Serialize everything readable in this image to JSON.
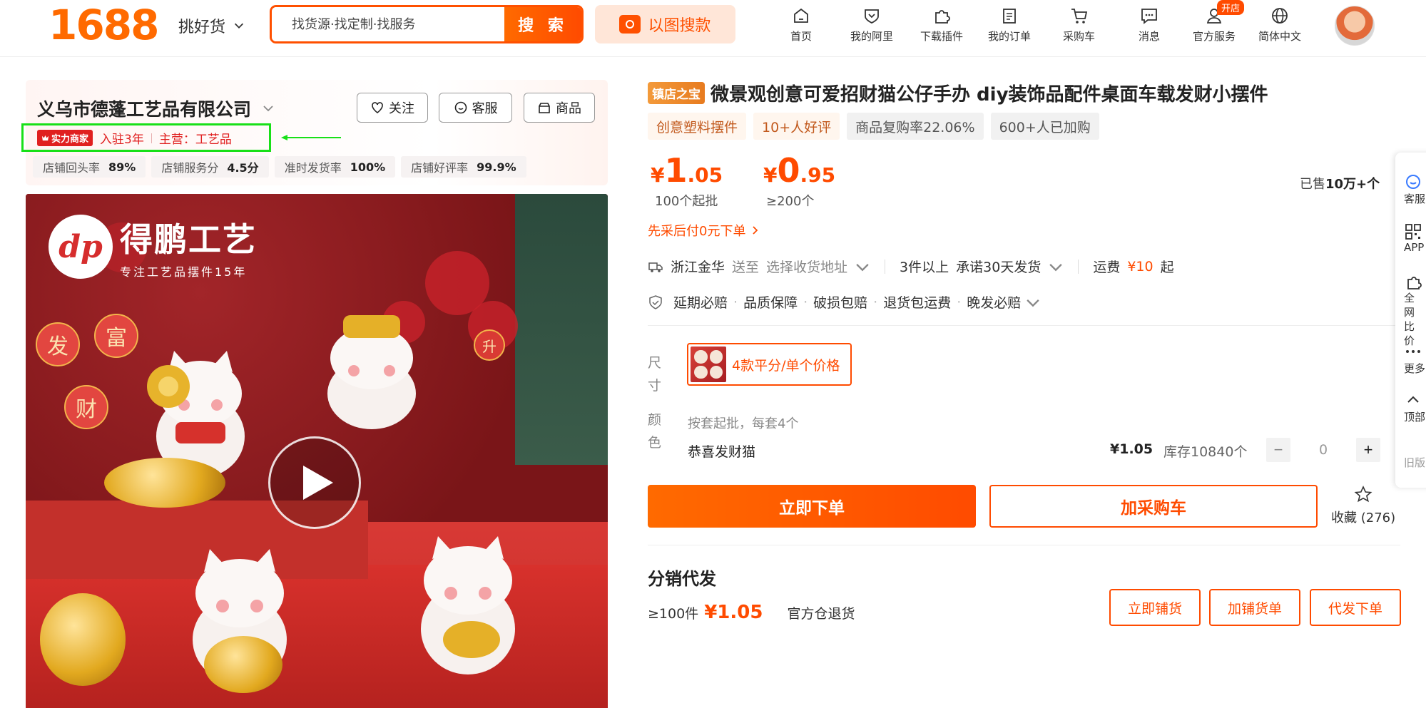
{
  "header": {
    "logo": "1688",
    "pick_goods": "挑好货",
    "search_placeholder": "找货源·找定制·找服务",
    "search_button": "搜 索",
    "image_search": "以图搜款",
    "open_shop_badge": "开店",
    "nav": [
      {
        "label": "首页",
        "icon": "home-icon"
      },
      {
        "label": "我的阿里",
        "icon": "heart-shield-icon"
      },
      {
        "label": "下载插件",
        "icon": "puzzle-icon"
      },
      {
        "label": "我的订单",
        "icon": "clipboard-icon"
      },
      {
        "label": "采购车",
        "icon": "cart-icon"
      },
      {
        "label": "消息",
        "icon": "message-icon"
      },
      {
        "label": "官方服务",
        "icon": "user-icon"
      },
      {
        "label": "简体中文",
        "icon": "globe-icon"
      }
    ]
  },
  "shop": {
    "name": "义乌市德蓬工艺品有限公司",
    "follow": "关注",
    "service": "客服",
    "goods": "商品",
    "strength_badge": "实力商家",
    "years": "入驻3年",
    "main": "主营：工艺品",
    "stats": [
      {
        "label": "店铺回头率",
        "value": "89%"
      },
      {
        "label": "店铺服务分",
        "value": "4.5分"
      },
      {
        "label": "准时发货率",
        "value": "100%"
      },
      {
        "label": "店铺好评率",
        "value": "99.9%"
      }
    ]
  },
  "image": {
    "brand_mark": "dp",
    "brand_name": "得鹏工艺",
    "brand_sub": "专注工艺品摆件15年",
    "lanterns": [
      "发",
      "富",
      "财",
      "升"
    ]
  },
  "product": {
    "store_tag": "镇店之宝",
    "title": "微景观创意可爱招财猫公仔手办 diy装饰品配件桌面车载发财小摆件",
    "tags": [
      {
        "text": "创意塑料摆件",
        "style": "warm"
      },
      {
        "text": "10+人好评",
        "style": "warm"
      },
      {
        "text": "商品复购率22.06%",
        "style": "grey"
      },
      {
        "text": "600+人已加购",
        "style": "grey"
      }
    ],
    "prices": [
      {
        "currency": "¥",
        "int": "1",
        "dec": ".05",
        "label": "100个起批"
      },
      {
        "currency": "¥",
        "int": "0",
        "dec": ".95",
        "label": "≥200个"
      }
    ],
    "sold_prefix": "已售",
    "sold_value": "10万+个",
    "later_pay": "先采后付0元下单",
    "shipping": {
      "origin": "浙江金华",
      "send_to": "送至",
      "address": "选择收货地址",
      "qty_rule": "3件以上",
      "promise": "承诺30天发货",
      "fee_label": "运费",
      "fee": "¥10",
      "fee_suffix": "起"
    },
    "guarantees": [
      "延期必赔",
      "品质保障",
      "破损包赔",
      "退货包运费",
      "晚发必赔"
    ],
    "size_label": "尺寸",
    "size_option": "4款平分/单个价格",
    "color_label": "颜色",
    "color_hint": "按套起批，每套4个",
    "color_name": "恭喜发财猫",
    "color_price": "¥1.05",
    "stock": "库存10840个",
    "quantity": "0",
    "buy_now": "立即下单",
    "add_cart": "加采购车",
    "favorite": "收藏 (276)"
  },
  "distribution": {
    "title": "分销代发",
    "min": "≥100件",
    "price": "¥1.05",
    "return": "官方仓退货",
    "buttons": [
      "立即铺货",
      "加铺货单",
      "代发下单"
    ]
  },
  "float_bar": [
    {
      "label": "客服",
      "icon": "service-icon"
    },
    {
      "label": "APP",
      "icon": "qr-icon"
    },
    {
      "label": "全网比价",
      "icon": "compare-icon"
    },
    {
      "label": "更多",
      "icon": "more-icon"
    },
    {
      "label": "顶部",
      "icon": "chevron-up-icon"
    },
    {
      "label": "旧版",
      "icon": ""
    }
  ],
  "colors": {
    "accent": "#ff5000",
    "highlight_box": "#18e018"
  }
}
